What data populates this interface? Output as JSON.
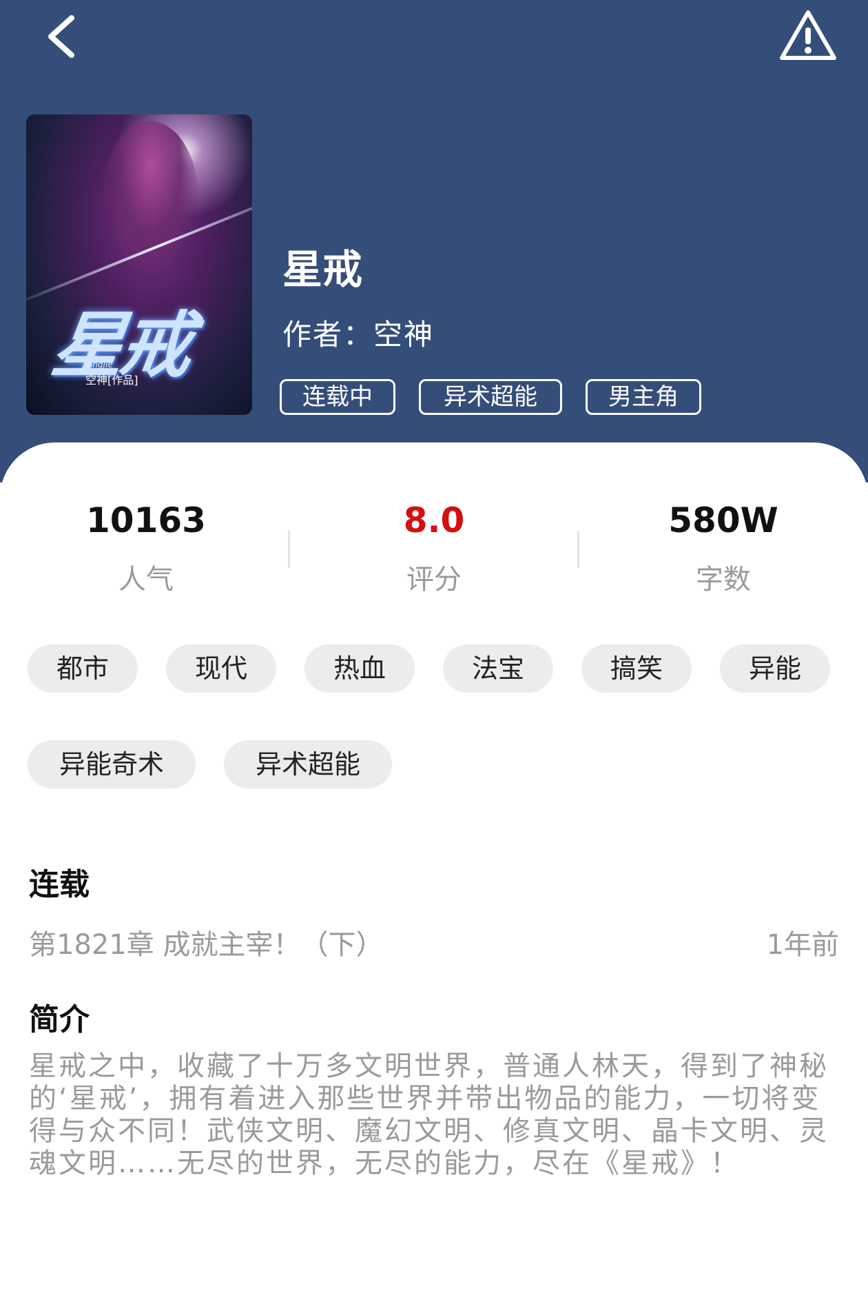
{
  "header": {
    "back_icon": "chevron-left-icon",
    "report_icon": "warning-triangle-icon",
    "background": "#354d79"
  },
  "book": {
    "cover": {
      "title_art": "星戒",
      "pinyin": "xingjie",
      "subtitle": "空神[作品]"
    },
    "title": "星戒",
    "author_line": "作者：空神",
    "header_tags": [
      "连载中",
      "异术超能",
      "男主角"
    ]
  },
  "stats": [
    {
      "value": "10163",
      "label": "人气"
    },
    {
      "value": "8.0",
      "label": "评分",
      "color": "#d50f0f"
    },
    {
      "value": "580W",
      "label": "字数"
    }
  ],
  "genre_tags": [
    "都市",
    "现代",
    "热血",
    "法宝",
    "搞笑",
    "异能",
    "异能奇术",
    "异术超能"
  ],
  "serial": {
    "heading": "连载",
    "latest_chapter": "第1821章 成就主宰！（下）",
    "updated": "1年前"
  },
  "synopsis": {
    "heading": "简介",
    "text": "星戒之中，收藏了十万多文明世界，普通人林天，得到了神秘的‘星戒’，拥有着进入那些世界并带出物品的能力，一切将变得与众不同！武侠文明、魔幻文明、修真文明、晶卡文明、灵魂文明……无尽的世界，无尽的能力，尽在《星戒》！"
  }
}
